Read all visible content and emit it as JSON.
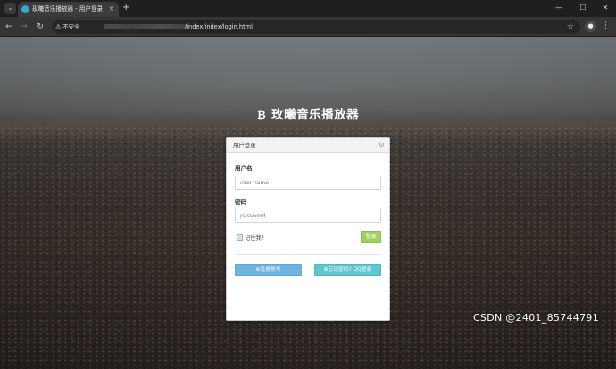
{
  "browser": {
    "tab_menu_icon": "chevron-down-icon",
    "tab_title": "玫曦音乐播放器 - 用户登录",
    "tab_close": "✕",
    "new_tab": "+",
    "window_controls": [
      "—",
      "☐",
      "✕"
    ],
    "nav": {
      "back": "←",
      "forward": "→",
      "reload": "↻"
    },
    "security_label": "不安全",
    "url_path": "/index/index/login.html",
    "star": "☆",
    "profile_icon": "person-icon",
    "menu": "⋮"
  },
  "page": {
    "brand_icon": "₿",
    "brand_title": "玫曦音乐播放器"
  },
  "login": {
    "panel_title": "用户登录",
    "settings_icon": "⚙",
    "username_label": "用户名",
    "username_placeholder": "user name..",
    "password_label": "密码",
    "password_placeholder": "password..",
    "remember_label": "记住我?",
    "login_button": "登录",
    "register_button": "⊕注册账号",
    "forgot_button": "⊕忘记密码? QQ登录"
  },
  "colors": {
    "login_green": "#9ed160",
    "register_blue": "#6fb3e0",
    "forgot_teal": "#5dc6d0"
  },
  "watermark": "CSDN @2401_85744791"
}
